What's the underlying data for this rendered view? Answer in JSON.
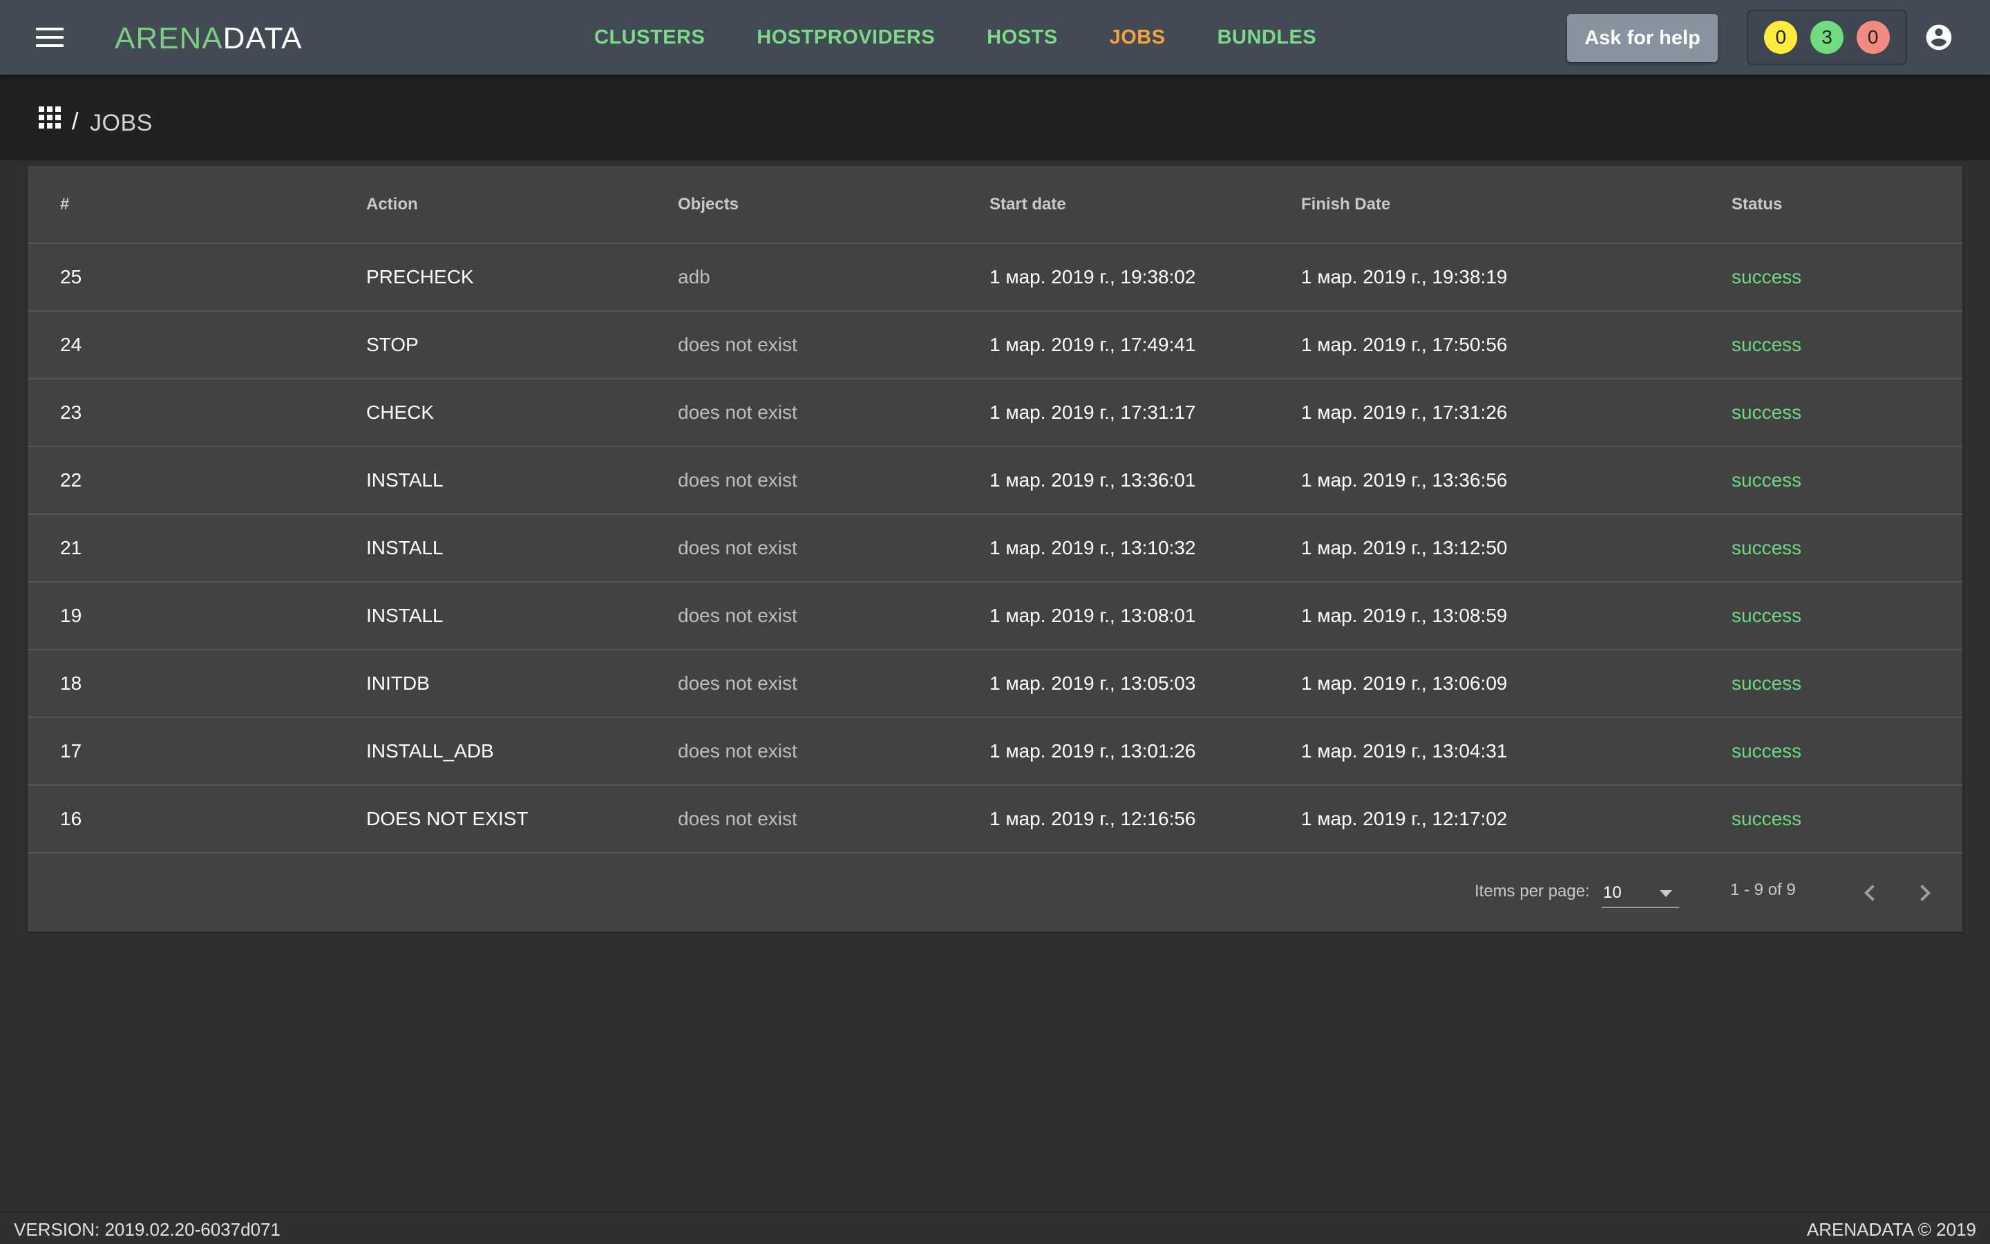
{
  "header": {
    "logo_part1": "ARENA",
    "logo_part2": "DATA",
    "nav": [
      {
        "label": "CLUSTERS"
      },
      {
        "label": "HOSTPROVIDERS"
      },
      {
        "label": "HOSTS"
      },
      {
        "label": "JOBS",
        "active": true
      },
      {
        "label": "BUNDLES"
      }
    ],
    "help_label": "Ask for help",
    "counters": [
      {
        "value": "0",
        "color": "#ffec3d"
      },
      {
        "value": "3",
        "color": "#6fdc7f"
      },
      {
        "value": "0",
        "color": "#f28b82"
      }
    ],
    "icons": {
      "menu": "menu-icon",
      "apps": "apps-grid-icon",
      "account": "account-circle-icon"
    },
    "colors": {
      "nav": "#7bd98a",
      "nav_active": "#f5a33f",
      "topbar": "#424a53"
    }
  },
  "breadcrumb": {
    "separator": "/",
    "current": "JOBS"
  },
  "table": {
    "columns": [
      "#",
      "Action",
      "Objects",
      "Start date",
      "Finish Date",
      "Status"
    ],
    "rows": [
      {
        "id": "25",
        "action": "PRECHECK",
        "objects": "adb",
        "start": "1 мар. 2019 г., 19:38:02",
        "finish": "1 мар. 2019 г., 19:38:19",
        "status": "success"
      },
      {
        "id": "24",
        "action": "STOP",
        "objects": "does not exist",
        "start": "1 мар. 2019 г., 17:49:41",
        "finish": "1 мар. 2019 г., 17:50:56",
        "status": "success"
      },
      {
        "id": "23",
        "action": "CHECK",
        "objects": "does not exist",
        "start": "1 мар. 2019 г., 17:31:17",
        "finish": "1 мар. 2019 г., 17:31:26",
        "status": "success"
      },
      {
        "id": "22",
        "action": "INSTALL",
        "objects": "does not exist",
        "start": "1 мар. 2019 г., 13:36:01",
        "finish": "1 мар. 2019 г., 13:36:56",
        "status": "success"
      },
      {
        "id": "21",
        "action": "INSTALL",
        "objects": "does not exist",
        "start": "1 мар. 2019 г., 13:10:32",
        "finish": "1 мар. 2019 г., 13:12:50",
        "status": "success"
      },
      {
        "id": "19",
        "action": "INSTALL",
        "objects": "does not exist",
        "start": "1 мар. 2019 г., 13:08:01",
        "finish": "1 мар. 2019 г., 13:08:59",
        "status": "success"
      },
      {
        "id": "18",
        "action": "INITDB",
        "objects": "does not exist",
        "start": "1 мар. 2019 г., 13:05:03",
        "finish": "1 мар. 2019 г., 13:06:09",
        "status": "success"
      },
      {
        "id": "17",
        "action": "INSTALL_ADB",
        "objects": "does not exist",
        "start": "1 мар. 2019 г., 13:01:26",
        "finish": "1 мар. 2019 г., 13:04:31",
        "status": "success"
      },
      {
        "id": "16",
        "action": "DOES NOT EXIST",
        "objects": "does not exist",
        "start": "1 мар. 2019 г., 12:16:56",
        "finish": "1 мар. 2019 г., 12:17:02",
        "status": "success"
      }
    ]
  },
  "paginator": {
    "items_per_page_label": "Items per page:",
    "items_per_page": "10",
    "range": "1 - 9 of 9",
    "icons": {
      "prev": "chevron-left-icon",
      "next": "chevron-right-icon"
    }
  },
  "footer": {
    "version": "VERSION: 2019.02.20-6037d071",
    "copyright": "ARENADATA © 2019"
  }
}
